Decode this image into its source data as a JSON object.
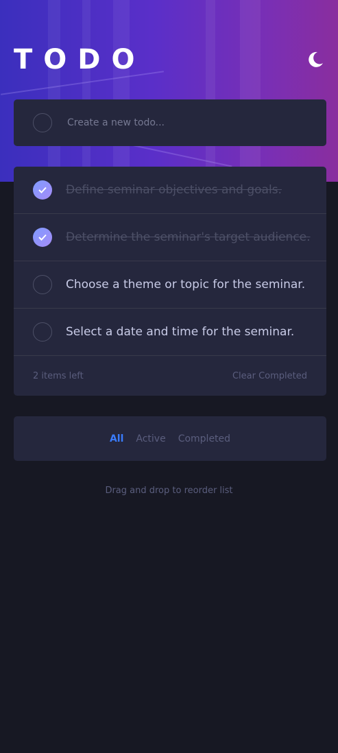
{
  "app": {
    "title": "TODO"
  },
  "colors": {
    "accent": "#3a7cfd",
    "card": "#25273d",
    "background": "#171823",
    "check_gradient": [
      "#7f9bff",
      "#a58cf7"
    ]
  },
  "icons": {
    "theme_toggle": "moon-icon",
    "check": "check-icon"
  },
  "create": {
    "placeholder": "Create a new todo..."
  },
  "todos": [
    {
      "text": "Define seminar objectives and goals.",
      "completed": true
    },
    {
      "text": "Determine the seminar's target audience.",
      "completed": true
    },
    {
      "text": "Choose a theme or topic for the seminar.",
      "completed": false
    },
    {
      "text": "Select a date and time for the seminar.",
      "completed": false
    }
  ],
  "footer": {
    "items_left": "2 items left",
    "clear_label": "Clear Completed"
  },
  "filters": {
    "all": "All",
    "active": "Active",
    "completed": "Completed",
    "selected": "All"
  },
  "hint": "Drag and drop to reorder list"
}
